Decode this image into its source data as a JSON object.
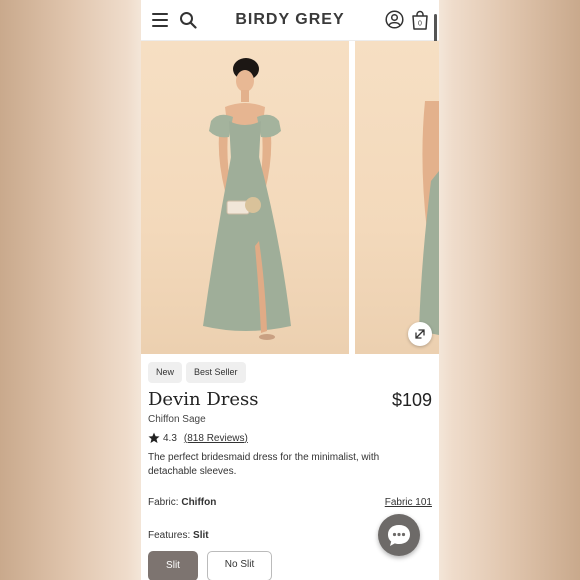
{
  "header": {
    "brand": "BIRDY GREY",
    "icons": [
      "menu-icon",
      "search-icon",
      "account-icon",
      "bag-icon"
    ],
    "cart_count": "0"
  },
  "badges": [
    "New",
    "Best Seller"
  ],
  "product": {
    "name": "Devin Dress",
    "price": "$109",
    "fabric_color": "Chiffon Sage",
    "rating": "4.3",
    "reviews": "(818 Reviews)",
    "description": "The perfect bridesmaid dress for the minimalist, with detachable sleeves.",
    "fabric_label": "Fabric:",
    "fabric_value": "Chiffon",
    "fabric_link": "Fabric 101",
    "features_label": "Features:",
    "features_value": "Slit",
    "options": [
      "Slit",
      "No Slit"
    ]
  },
  "colors": {
    "dress": "#9fae99",
    "selected_option": "#7d7470",
    "chat_button": "#6d6a68"
  }
}
